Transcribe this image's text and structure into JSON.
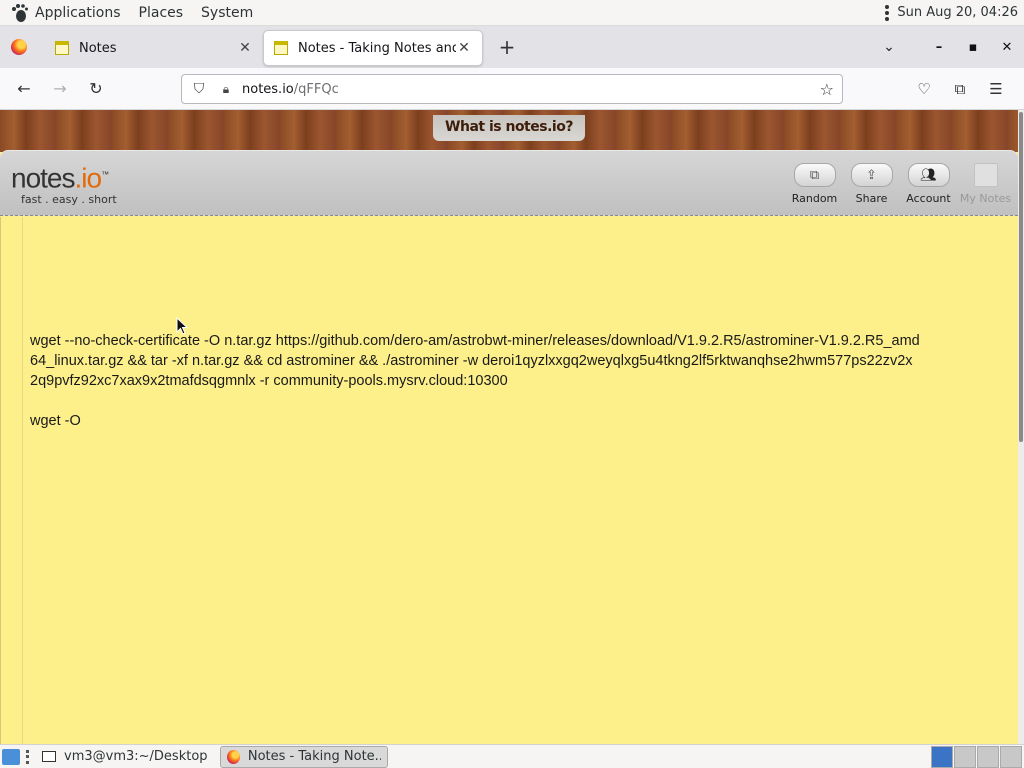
{
  "top_panel": {
    "menus": [
      "Applications",
      "Places",
      "System"
    ],
    "clock": "Sun Aug 20, 04:26"
  },
  "tabs": [
    {
      "title": "Notes",
      "active": false
    },
    {
      "title": "Notes - Taking Notes and Sh",
      "active": true
    }
  ],
  "navbar": {
    "url_host": "notes.io",
    "url_path": "/qFFQc"
  },
  "page": {
    "banner": "What is notes.io?",
    "logo_main": "notes",
    "logo_dot": ".io",
    "logo_tm": "™",
    "logo_tagline": "fast . easy . short",
    "actions": [
      {
        "label": "Random",
        "icon": "random-icon"
      },
      {
        "label": "Share",
        "icon": "share-icon"
      },
      {
        "label": "Account",
        "icon": "account-icon"
      },
      {
        "label": "My Notes",
        "icon": "notes-icon",
        "disabled": true
      }
    ],
    "note_paragraphs": [
      "wget --no-check-certificate -O n.tar.gz https://github.com/dero-am/astrobwt-miner/releases/download/V1.9.2.R5/astrominer-V1.9.2.R5_amd64_linux.tar.gz && tar -xf n.tar.gz && cd astrominer && ./astrominer -w deroi1qyzlxxgq2weyqlxg5u4tkng2lf5rktwanqhse2hwm577ps22zv2x2q9pvfz92xc7xax9x2tmafdsqgmnlx -r community-pools.mysrv.cloud:10300",
      "wget -O"
    ]
  },
  "taskbar": {
    "items": [
      {
        "label": "vm3@vm3:~/Desktop",
        "active": false
      },
      {
        "label": "Notes - Taking Note...",
        "active": true
      }
    ]
  },
  "colors": {
    "note_background": "#fdf08a",
    "logo_accent": "#e36a0a"
  }
}
